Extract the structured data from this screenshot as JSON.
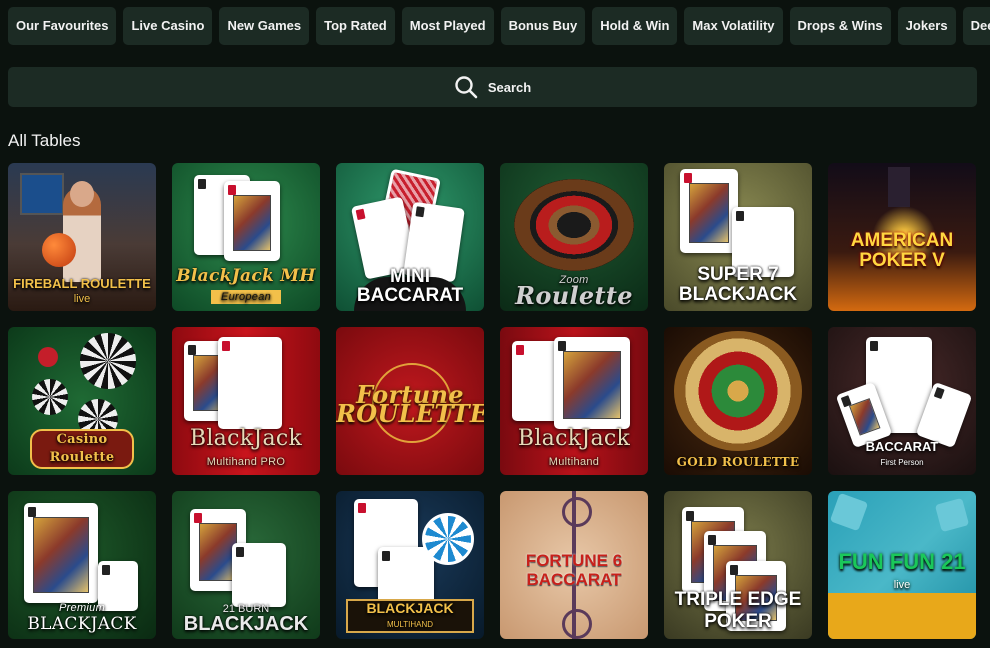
{
  "tabs": [
    "Our Favourites",
    "Live Casino",
    "New Games",
    "Top Rated",
    "Most Played",
    "Bonus Buy",
    "Hold & Win",
    "Max Volatility",
    "Drops & Wins",
    "Jokers",
    "Deep B"
  ],
  "search": {
    "label": "Search"
  },
  "section_title": "All Tables",
  "games": [
    {
      "title": "FIREBALL ROULETTE",
      "sub": "live"
    },
    {
      "title": "BlackJack MH",
      "sub": "European"
    },
    {
      "title": "MINI BACCARAT",
      "sub": ""
    },
    {
      "title": "Roulette",
      "sub": "Zoom"
    },
    {
      "title": "SUPER 7 BLACKJACK",
      "sub": ""
    },
    {
      "title": "AMERICAN POKER V",
      "sub": ""
    },
    {
      "title": "Casino Roulette",
      "sub": ""
    },
    {
      "title": "BlackJack",
      "sub": "Multihand PRO"
    },
    {
      "title": "Fortune ROULETTE",
      "sub": ""
    },
    {
      "title": "BlackJack",
      "sub": "Multihand"
    },
    {
      "title": "GOLD ROULETTE",
      "sub": ""
    },
    {
      "title": "BACCARAT",
      "sub": "First Person"
    },
    {
      "title": "BLACKJACK",
      "sub": "Premium"
    },
    {
      "title": "BLACKJACK",
      "sub": "21 BURN"
    },
    {
      "title": "BLACKJACK",
      "sub": "MULTIHAND"
    },
    {
      "title": "FORTUNE 6 BACCARAT",
      "sub": ""
    },
    {
      "title": "TRIPLE EDGE POKER",
      "sub": ""
    },
    {
      "title": "FUN FUN 21",
      "sub": "live"
    }
  ],
  "colors": {
    "background": "#0b120e",
    "pill": "#1c2b24",
    "text": "#f2f2f2"
  },
  "icons": {
    "search": "search-icon"
  }
}
